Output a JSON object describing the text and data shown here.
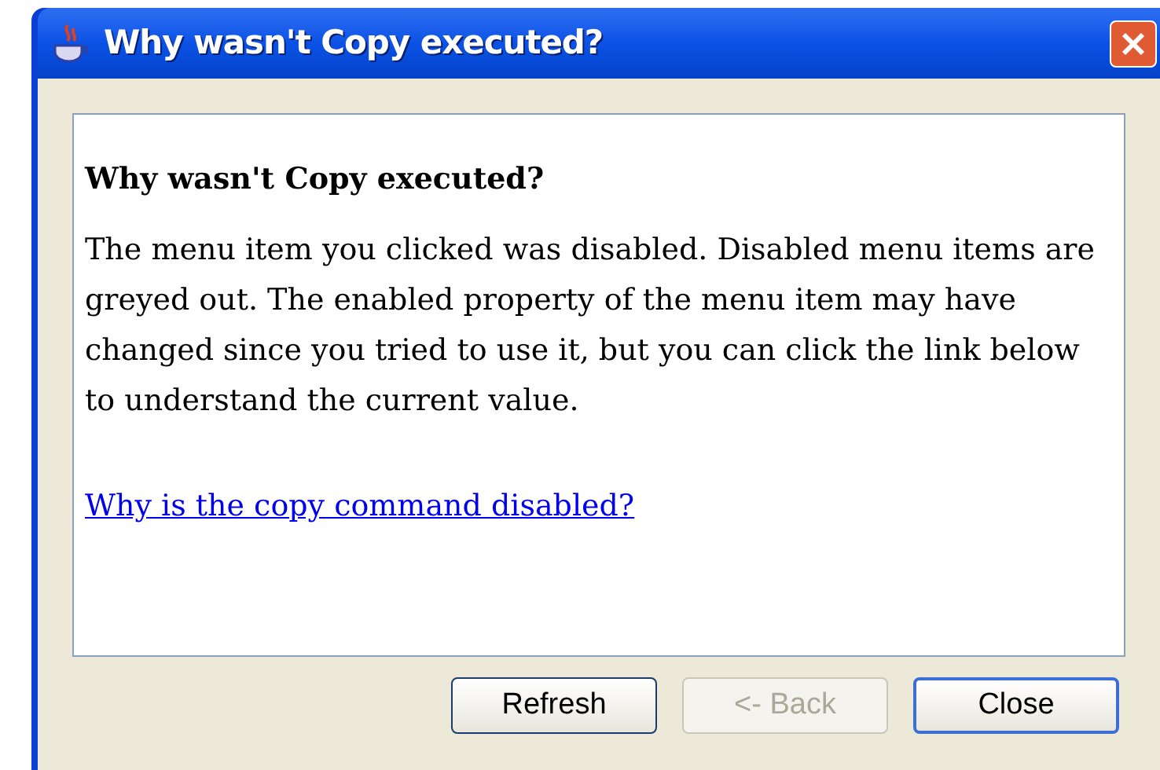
{
  "window": {
    "title": "Why wasn't Copy executed?"
  },
  "content": {
    "heading": "Why wasn't Copy executed?",
    "paragraph": "The menu item you clicked was disabled. Disabled menu items are greyed out. The enabled property of the menu item may have changed since you tried to use it, but you can click the link below to understand the current value.",
    "link": "Why is the copy command disabled?"
  },
  "buttons": [
    {
      "label": "Refresh",
      "disabled": false,
      "default": false
    },
    {
      "label": "<- Back",
      "disabled": true,
      "default": false
    },
    {
      "label": "Close",
      "disabled": false,
      "default": true
    }
  ]
}
